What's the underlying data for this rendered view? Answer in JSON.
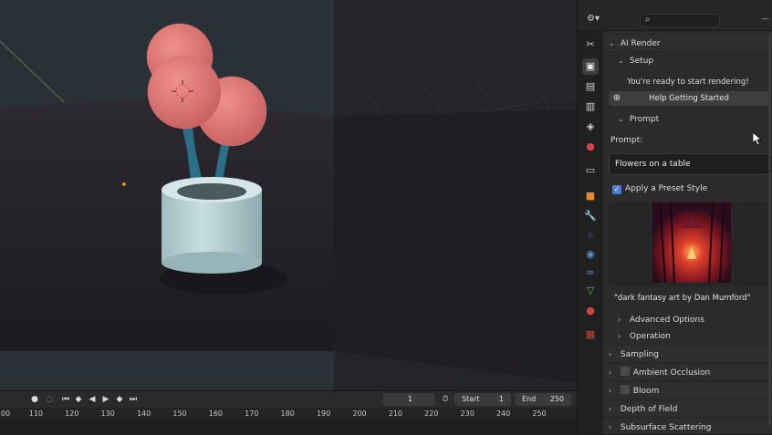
{
  "timeline": {
    "current_frame": "1",
    "start_label": "Start",
    "start_value": "1",
    "end_label": "End",
    "end_value": "250",
    "ticks": [
      "00",
      "110",
      "120",
      "130",
      "140",
      "150",
      "160",
      "170",
      "180",
      "190",
      "200",
      "210",
      "220",
      "230",
      "240",
      "250"
    ]
  },
  "properties": {
    "ai_render_label": "AI Render",
    "setup_label": "Setup",
    "ready_text": "You're ready to start rendering!",
    "help_button_label": "Help Getting Started",
    "prompt_section_label": "Prompt",
    "prompt_field_label": "Prompt:",
    "prompt_value": "Flowers on a table",
    "apply_preset_label": "Apply a Preset Style",
    "apply_preset_checked": true,
    "preset_caption": "\"dark fantasy art by Dan Mumford\"",
    "advanced_options_label": "Advanced Options",
    "operation_label": "Operation",
    "sampling_label": "Sampling",
    "ambient_occlusion_label": "Ambient Occlusion",
    "bloom_label": "Bloom",
    "depth_of_field_label": "Depth of Field",
    "subsurface_scattering_label": "Subsurface Scattering"
  },
  "icons": {
    "tabs": [
      "tool-icon",
      "render-icon",
      "output-icon",
      "view-layer-icon",
      "scene-icon",
      "world-icon",
      "collection-icon",
      "object-icon",
      "modifier-icon",
      "particles-icon",
      "physics-icon",
      "constraints-icon",
      "data-icon",
      "material-icon",
      "texture-icon"
    ]
  },
  "colors": {
    "accent_blue": "#4a7ed6",
    "panel_bg": "#2b2b2b",
    "flower_pink": "#e07a78",
    "vase": "#b9d1d3",
    "stem": "#2b6f87"
  }
}
